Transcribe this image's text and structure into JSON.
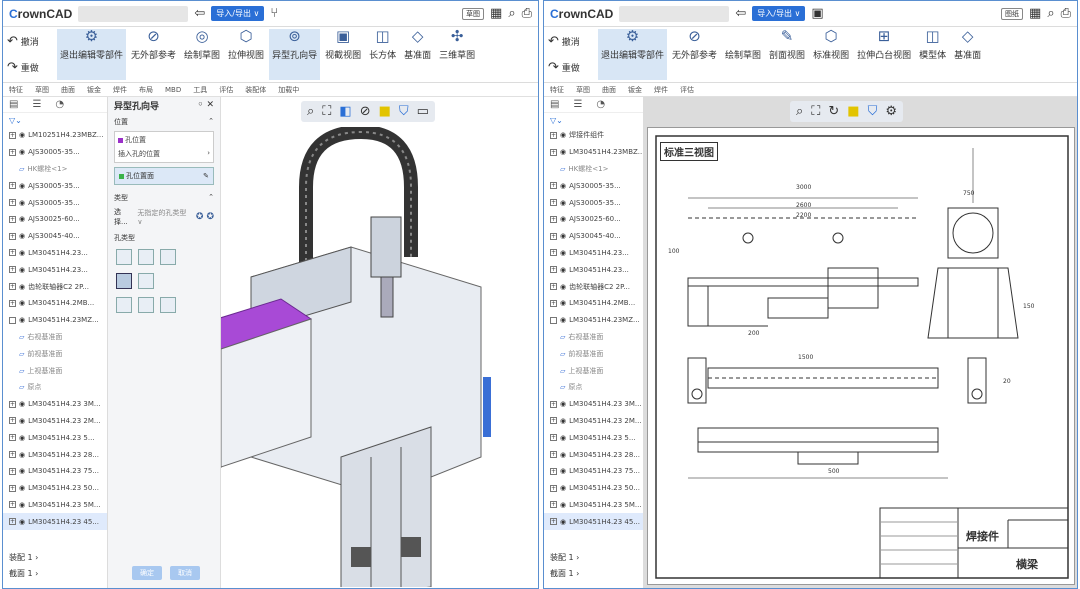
{
  "app": {
    "brand_prefix": "C",
    "brand_rest": "rownCAD"
  },
  "left": {
    "toolbar": {
      "import_label": "导入/导出 ∨",
      "mini_label": "草图"
    },
    "ribbon": {
      "undo": "撤消",
      "redo": "重做",
      "buttons": [
        "退出编辑零部件",
        "无外部参考",
        "绘制草图",
        "拉伸视图",
        "异型孔向导",
        "视截视图",
        "长方体",
        "基准面",
        "三维草图"
      ]
    },
    "tabs": [
      "特征",
      "草图",
      "曲面",
      "钣金",
      "焊件",
      "布局",
      "MBD",
      "工具",
      "评估",
      "装配体",
      "加载中"
    ],
    "tree": {
      "items": [
        {
          "t": "LM10251H4.23MBZ...",
          "k": "top"
        },
        {
          "t": "AJS30005-35...",
          "k": "n"
        },
        {
          "t": "HK螺栓<1>",
          "k": "s"
        },
        {
          "t": "AJS30005-35...",
          "k": "n"
        },
        {
          "t": "AJS30005-35...",
          "k": "n"
        },
        {
          "t": "AJS30025-60...",
          "k": "n"
        },
        {
          "t": "AJS30045-40...",
          "k": "n"
        },
        {
          "t": "LM30451H4.23...",
          "k": "n"
        },
        {
          "t": "LM30451H4.23...",
          "k": "n"
        },
        {
          "t": "齿轮联轴器C2 2P...",
          "k": "n"
        },
        {
          "t": "LM30451H4.2MB...",
          "k": "n"
        },
        {
          "t": "LM30451H4.23MZ...",
          "k": "c"
        },
        {
          "t": "右视基准面",
          "k": "s"
        },
        {
          "t": "前视基准面",
          "k": "s"
        },
        {
          "t": "上视基准面",
          "k": "s"
        },
        {
          "t": "原点",
          "k": "s"
        },
        {
          "t": "LM30451H4.23 3M...",
          "k": "n"
        },
        {
          "t": "LM30451H4.23 2M...",
          "k": "n"
        },
        {
          "t": "LM30451H4.23 5...",
          "k": "n"
        },
        {
          "t": "LM30451H4.23 28...",
          "k": "n"
        },
        {
          "t": "LM30451H4.23 75...",
          "k": "n"
        },
        {
          "t": "LM30451H4.23 50...",
          "k": "n"
        },
        {
          "t": "LM30451H4.23 5M...",
          "k": "n"
        },
        {
          "t": "LM30451H4.23 45...",
          "k": "sel"
        }
      ],
      "footer": [
        "装配 1 ›",
        "截面 1 ›"
      ]
    },
    "panel": {
      "title": "异型孔向导",
      "sec_position": "位置",
      "hint1": "孔位置",
      "hint2": "插入孔的位置",
      "face_label": "孔位置面",
      "sec_type": "类型",
      "select_label": "选择...",
      "select_value": "无指定的孔类型 ∨",
      "sec_hole_type": "孔类型",
      "ok_label": "确定",
      "cancel_label": "取消"
    }
  },
  "right": {
    "toolbar": {
      "import_label": "导入/导出 ∨",
      "mini_label": "图纸"
    },
    "ribbon": {
      "undo": "撤消",
      "redo": "重做",
      "buttons": [
        "退出编辑零部件",
        "无外部参考",
        "绘制草图",
        "剖面视图",
        "标准视图",
        "拉伸凸台视图",
        "模型体",
        "基准面"
      ]
    },
    "tabs": [
      "特征",
      "草图",
      "曲面",
      "钣金",
      "焊件",
      "评估"
    ],
    "tree": {
      "items": [
        {
          "t": "焊接件组件",
          "k": "top"
        },
        {
          "t": "LM30451H4.23MBZ...",
          "k": "n"
        },
        {
          "t": "HK螺栓<1>",
          "k": "s"
        },
        {
          "t": "AJS30005-35...",
          "k": "n"
        },
        {
          "t": "AJS30005-35...",
          "k": "n"
        },
        {
          "t": "AJS30025-60...",
          "k": "n"
        },
        {
          "t": "AJS30045-40...",
          "k": "n"
        },
        {
          "t": "LM30451H4.23...",
          "k": "n"
        },
        {
          "t": "LM30451H4.23...",
          "k": "n"
        },
        {
          "t": "齿轮联轴器C2 2P...",
          "k": "n"
        },
        {
          "t": "LM30451H4.2MB...",
          "k": "n"
        },
        {
          "t": "LM30451H4.23MZ...",
          "k": "c"
        },
        {
          "t": "右视基准面",
          "k": "s"
        },
        {
          "t": "前视基准面",
          "k": "s"
        },
        {
          "t": "上视基准面",
          "k": "s"
        },
        {
          "t": "原点",
          "k": "s"
        },
        {
          "t": "LM30451H4.23 3M...",
          "k": "n"
        },
        {
          "t": "LM30451H4.23 2M...",
          "k": "n"
        },
        {
          "t": "LM30451H4.23 5...",
          "k": "n"
        },
        {
          "t": "LM30451H4.23 28...",
          "k": "n"
        },
        {
          "t": "LM30451H4.23 75...",
          "k": "n"
        },
        {
          "t": "LM30451H4.23 50...",
          "k": "n"
        },
        {
          "t": "LM30451H4.23 5M...",
          "k": "n"
        },
        {
          "t": "LM30451H4.23 45...",
          "k": "sel"
        }
      ],
      "footer": [
        "装配 1 ›",
        "截面 1 ›"
      ]
    },
    "drawing": {
      "title": "标准三视图",
      "tb_part": "焊接件",
      "tb_name": "横梁",
      "dims": [
        "3000",
        "2600",
        "2200",
        "1500",
        "750",
        "500",
        "200",
        "150",
        "100",
        "20"
      ]
    }
  }
}
